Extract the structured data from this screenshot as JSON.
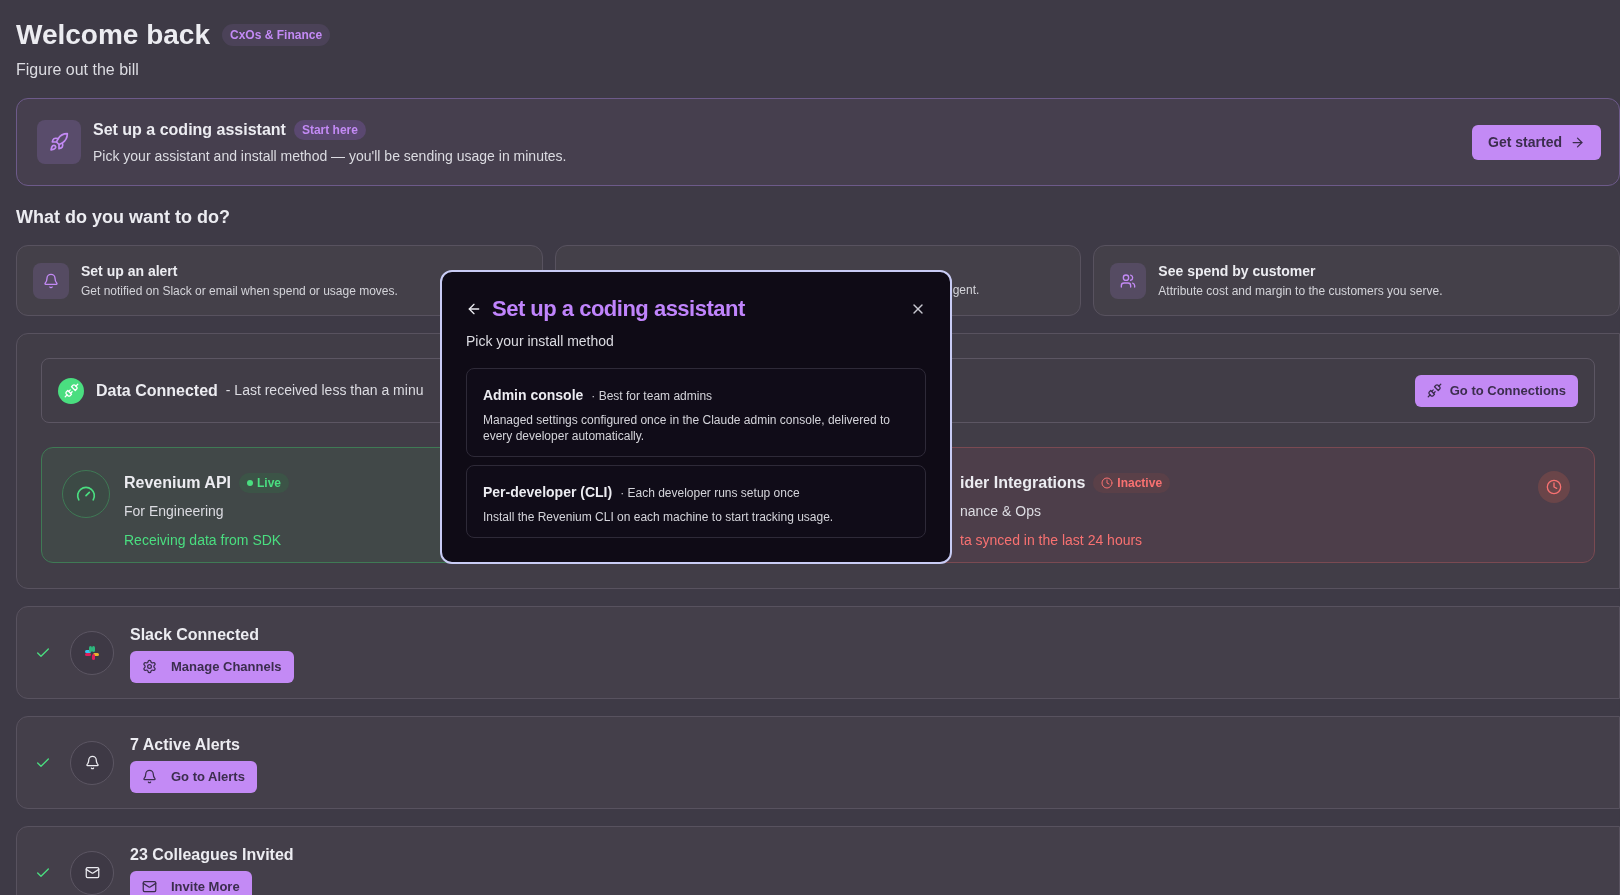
{
  "header": {
    "title": "Welcome back",
    "badge": "CxOs & Finance",
    "subtitle": "Figure out the bill"
  },
  "setup_banner": {
    "title": "Set up a coding assistant",
    "badge": "Start here",
    "description": "Pick your assistant and install method — you'll be sending usage in minutes.",
    "button": "Get started"
  },
  "section_title": "What do you want to do?",
  "actions": [
    {
      "title": "Set up an alert",
      "description": "Get notified on Slack or email when spend or usage moves."
    },
    {
      "description": "gent."
    },
    {
      "title": "See spend by customer",
      "description": "Attribute cost and margin to the customers you serve."
    }
  ],
  "connection": {
    "title": "Data Connected",
    "detail": "- Last received less than a minu",
    "button": "Go to Connections"
  },
  "sources": [
    {
      "kind": "live",
      "title": "Revenium API",
      "status": "Live",
      "subtitle": "For Engineering",
      "message": "Receiving data from SDK"
    },
    {
      "kind": "inactive",
      "title": "ider Integrations",
      "status": "Inactive",
      "subtitle": "nance & Ops",
      "message": "ta synced in the last 24 hours"
    }
  ],
  "checklist": [
    {
      "title": "Slack Connected",
      "button": "Manage Channels",
      "done": true
    },
    {
      "title": "7 Active Alerts",
      "button": "Go to Alerts",
      "done": true
    },
    {
      "title": "23 Colleagues Invited",
      "button": "Invite More",
      "done": true
    }
  ],
  "modal": {
    "title": "Set up a coding assistant",
    "subtitle": "Pick your install method",
    "options": [
      {
        "title": "Admin console",
        "note": "· Best for team admins",
        "description": "Managed settings configured once in the Claude admin console, delivered to every developer automatically."
      },
      {
        "title": "Per-developer (CLI)",
        "note": "· Each developer runs setup once",
        "description": "Install the Revenium CLI on each machine to start tracking usage."
      }
    ]
  }
}
